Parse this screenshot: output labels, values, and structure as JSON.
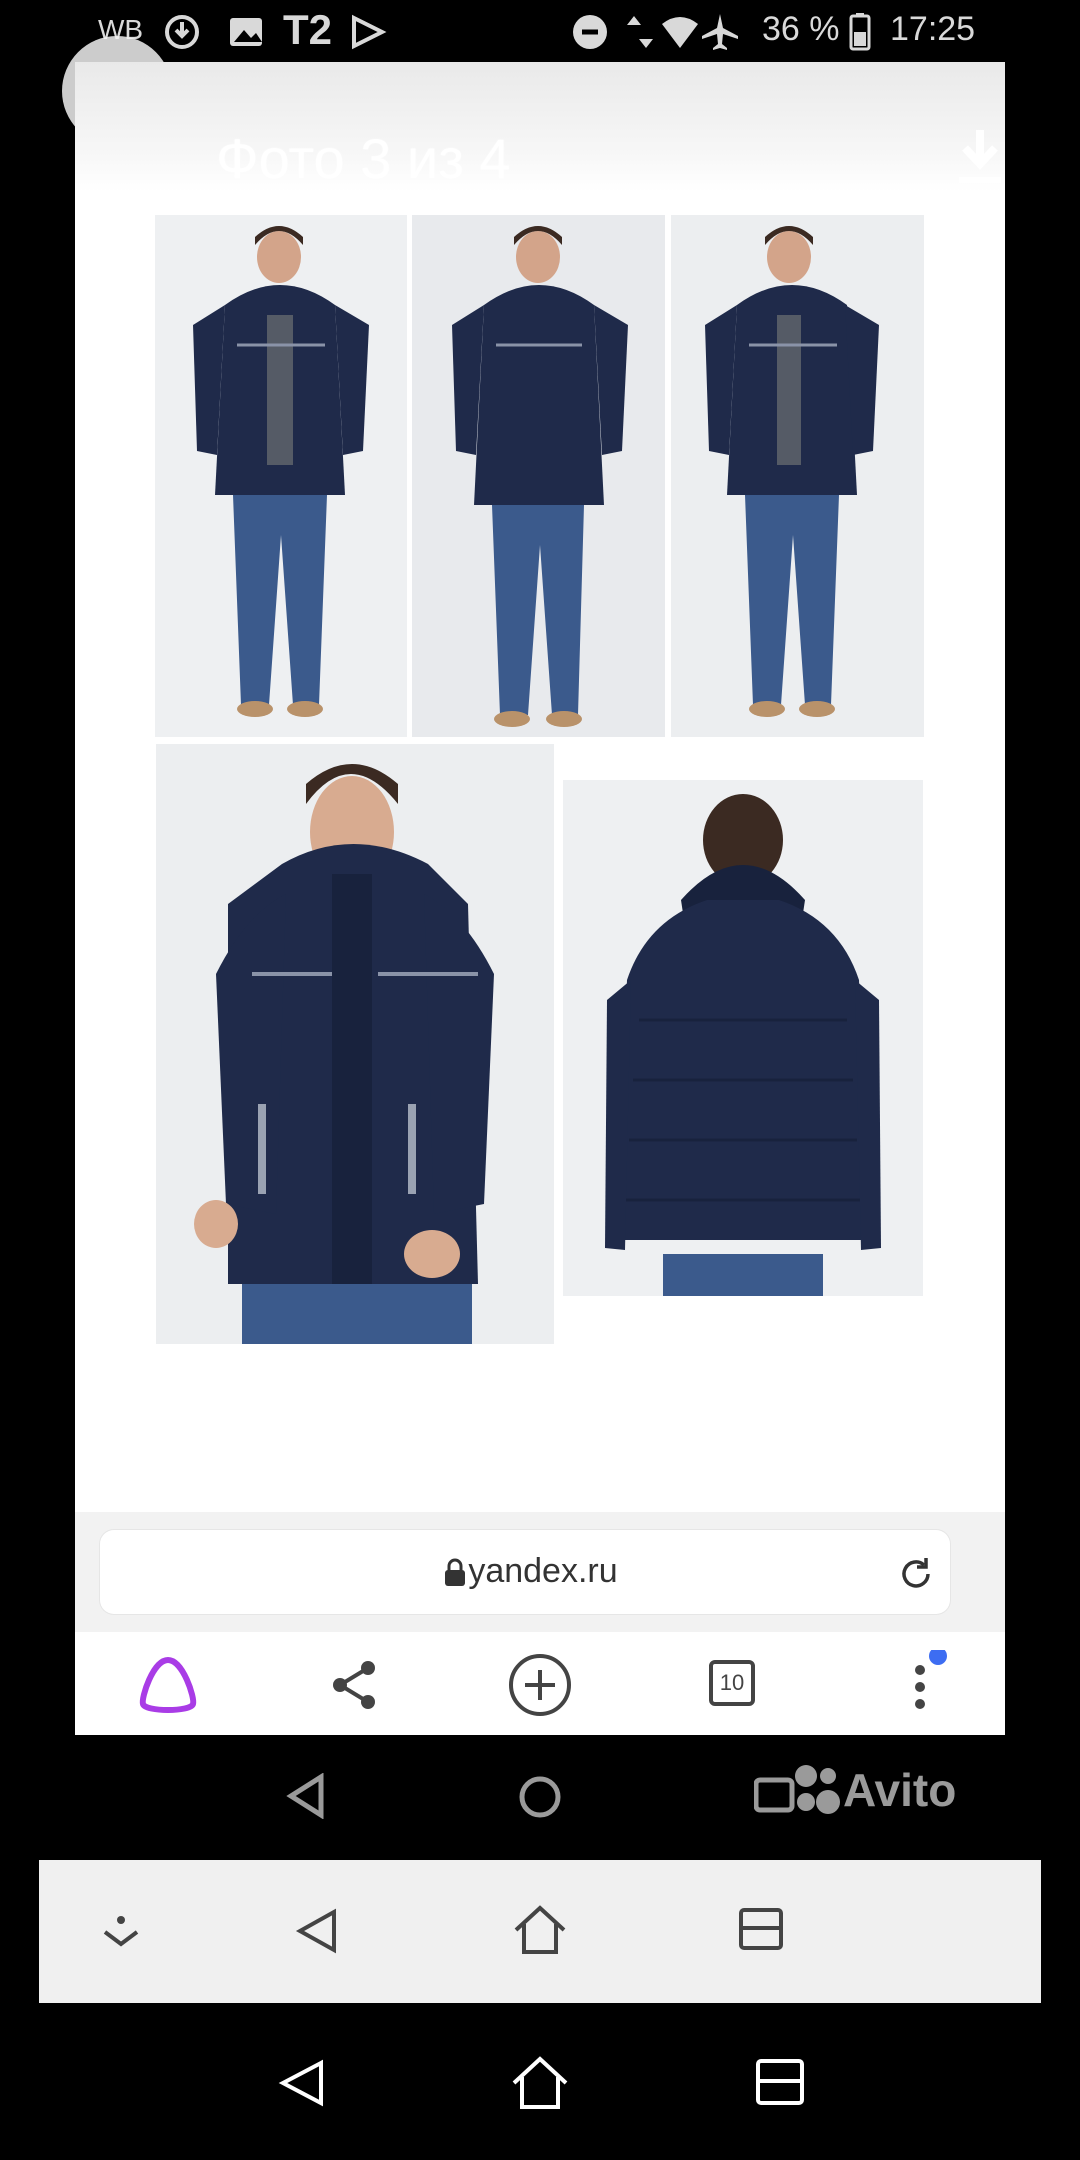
{
  "status_bar": {
    "carrier_left": "WB",
    "operator": "T2",
    "battery": "36 %",
    "time": "17:25"
  },
  "viewer": {
    "title": "Фото 3 из 4"
  },
  "browser": {
    "url": "yandex.ru",
    "tabs_count": "10"
  },
  "watermark": {
    "brand": "Avito"
  },
  "colors": {
    "jacket": "#1f2a4a",
    "jeans": "#3b5a8c",
    "background_panel": "#ecedef",
    "alice_purple": "#a93ce6",
    "notification_dot": "#3d6df2"
  }
}
